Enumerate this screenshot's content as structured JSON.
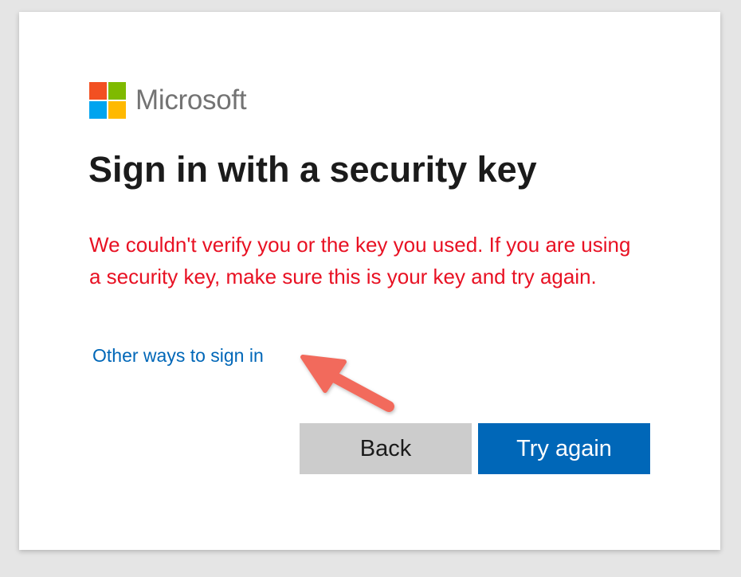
{
  "brand": {
    "name": "Microsoft",
    "logo_colors": [
      "#f25022",
      "#7fba00",
      "#00a4ef",
      "#ffb900"
    ]
  },
  "page": {
    "title": "Sign in with a security key",
    "error_message": "We couldn't verify you or the key you used. If you are using a security key, make sure this is your key and try again.",
    "error_color": "#e81123"
  },
  "links": {
    "other_ways": "Other ways to sign in"
  },
  "buttons": {
    "back_label": "Back",
    "try_again_label": "Try again",
    "accent_color": "#0067b8"
  },
  "annotation": {
    "arrow_icon": "pointer-arrow-icon",
    "arrow_color": "#f26b5b"
  }
}
